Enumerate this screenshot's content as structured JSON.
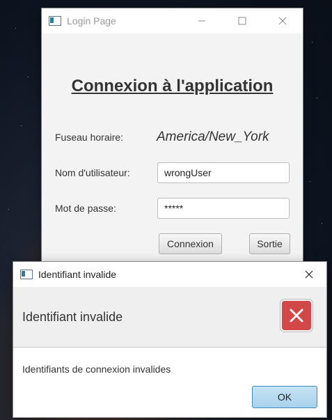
{
  "login_window": {
    "title": "Login Page",
    "heading": "Connexion à l'application",
    "timezone_label": "Fuseau horaire:",
    "timezone_value": "America/New_York",
    "username_label": "Nom d'utilisateur:",
    "username_value": "wrongUser",
    "password_label": "Mot de passe:",
    "password_value": "*****",
    "connect_button": "Connexion",
    "exit_button": "Sortie"
  },
  "error_dialog": {
    "title": "Identifiant invalide",
    "header_text": "Identifiant invalide",
    "content_text": "Identifiants de connexion invalides",
    "ok_button": "OK",
    "icon": "error-x-icon",
    "icon_color": "#d24848"
  },
  "icons": {
    "app_icon": "window-app-icon",
    "minimize": "minimize-icon",
    "maximize": "maximize-icon",
    "close": "close-icon"
  }
}
